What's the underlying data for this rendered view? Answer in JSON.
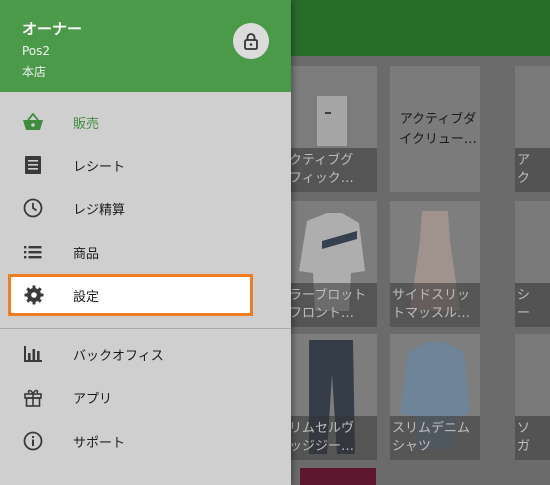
{
  "header": {
    "owner": "オーナー",
    "pos": "Pos2",
    "store": "本店"
  },
  "menu": {
    "sales": "販売",
    "receipt": "レシート",
    "settlement": "レジ精算",
    "products": "商品",
    "settings": "設定",
    "backoffice": "バックオフィス",
    "apps": "アプリ",
    "support": "サポート"
  },
  "products": {
    "p1": "クティブグ\nフィック…",
    "p2": "アクティブダ\nイクリュー…",
    "p3": "ア\nク",
    "p4": "ラーブロット\nフロント…",
    "p5": "サイドスリッ\nトマッスル…",
    "p6": "シ\nー",
    "p7": "リムセルヴ\nッジジー…",
    "p8": "スリムデニム\nシャツ",
    "p9": "ソ\nガ"
  },
  "colors": {
    "accent": "#4a9a4a",
    "highlight": "#ef7d22"
  }
}
